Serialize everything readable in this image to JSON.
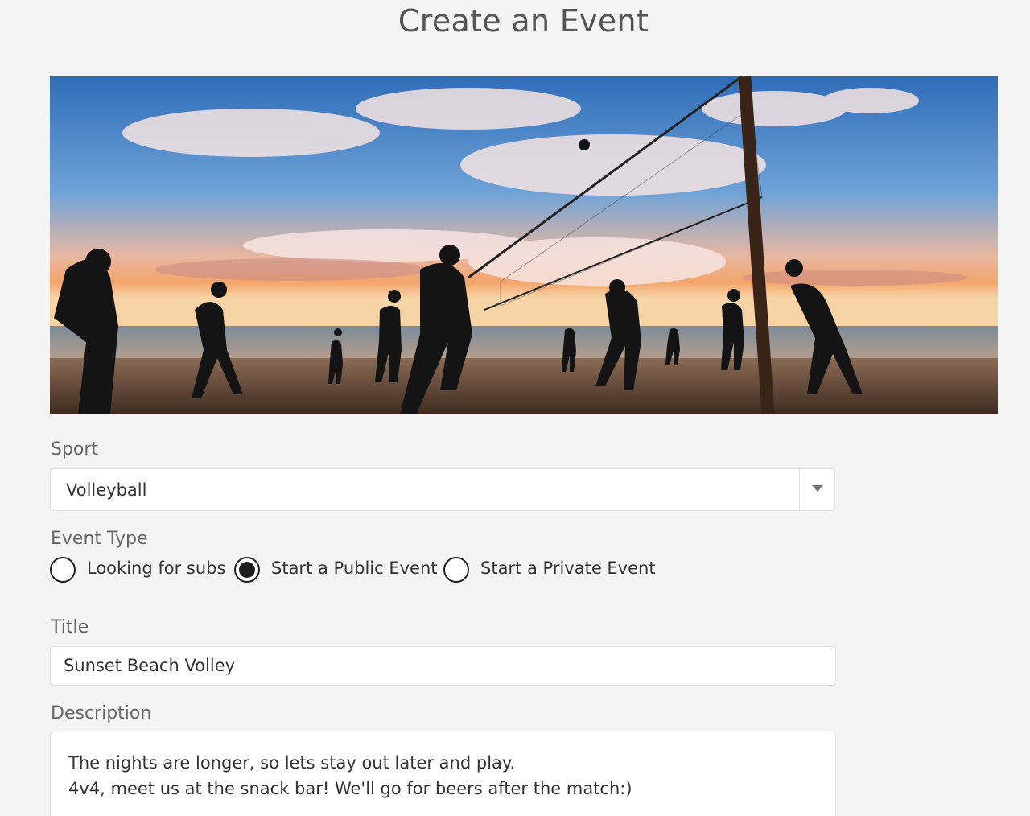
{
  "page": {
    "title": "Create an Event"
  },
  "hero": {
    "alt": "Beach volleyball players silhouetted at sunset"
  },
  "sport": {
    "label": "Sport",
    "selected": "Volleyball"
  },
  "event_type": {
    "label": "Event Type",
    "options": [
      {
        "label": "Looking for subs",
        "checked": false
      },
      {
        "label": "Start a Public Event",
        "checked": true
      },
      {
        "label": "Start a Private Event",
        "checked": false
      }
    ]
  },
  "title_field": {
    "label": "Title",
    "value": "Sunset Beach Volley"
  },
  "description": {
    "label": "Description",
    "lines": [
      "The nights are longer, so lets stay out later and play.",
      "4v4, meet us at the snack bar! We'll go for beers after the match:)"
    ]
  },
  "colors": {
    "background": "#f4f4f4",
    "field_border": "#e1e1e1",
    "radio_fill": "#1e1e1e"
  }
}
